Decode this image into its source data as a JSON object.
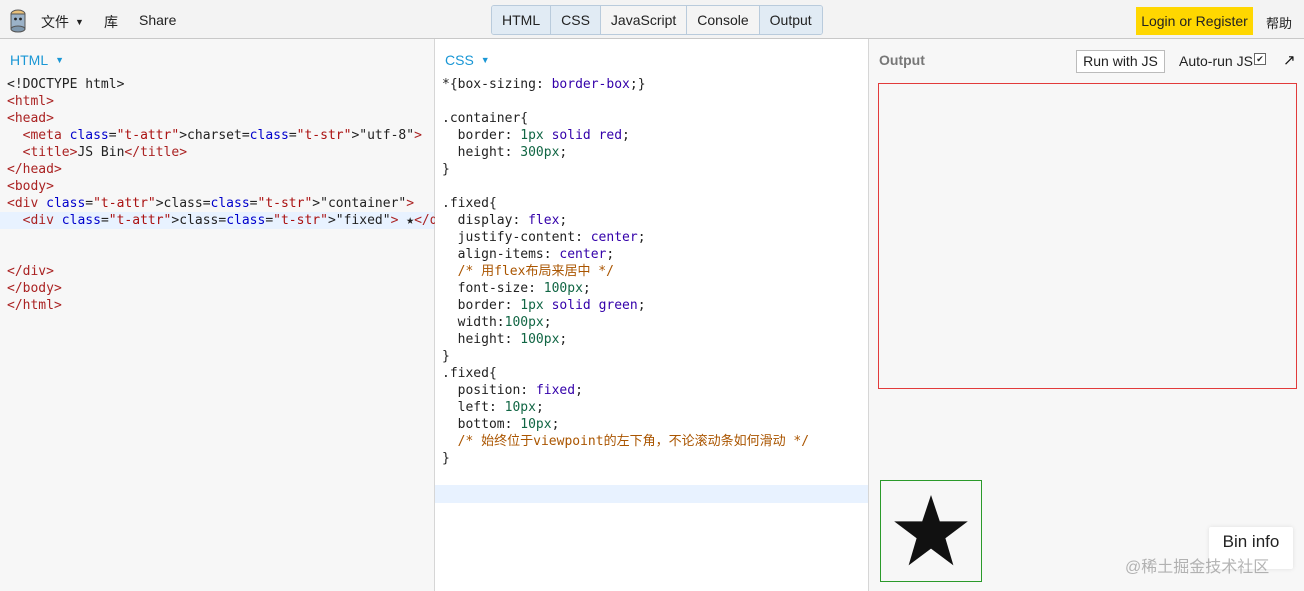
{
  "topbar": {
    "menu_file": "文件",
    "menu_library": "库",
    "menu_share": "Share",
    "panels": [
      "HTML",
      "CSS",
      "JavaScript",
      "Console",
      "Output"
    ],
    "login_label": "Login or Register",
    "help_label": "帮助"
  },
  "html_panel": {
    "label": "HTML",
    "lines": [
      "<!DOCTYPE html>",
      "<html>",
      "<head>",
      "  <meta charset=\"utf-8\">",
      "  <title>JS Bin</title>",
      "</head>",
      "<body>",
      "<div class=\"container\">",
      "  <div class=\"fixed\"> ★</div>",
      "",
      "",
      "</div>",
      "</body>",
      "</html>"
    ]
  },
  "css_panel": {
    "label": "CSS",
    "lines": [
      "*{box-sizing: border-box;}",
      "",
      ".container{",
      "  border: 1px solid red;",
      "  height: 300px;",
      "}",
      "",
      ".fixed{",
      "  display: flex;",
      "  justify-content: center;",
      "  align-items: center;",
      "  /* 用flex布局来居中 */",
      "  font-size: 100px;",
      "  border: 1px solid green;",
      "  width:100px;",
      "  height: 100px;",
      "}",
      ".fixed{",
      "  position: fixed;",
      "  left: 10px;",
      "  bottom: 10px;",
      "  /* 始终位于viewpoint的左下角，不论滚动条如何滑动 */",
      "}"
    ]
  },
  "output_panel": {
    "title": "Output",
    "run_label": "Run with JS",
    "autorun_label": "Auto-run JS",
    "autorun_checked": "✔",
    "expand_icon": "↗",
    "star": "★",
    "bin_info": "Bin info",
    "watermark": "@稀土掘金技术社区"
  }
}
